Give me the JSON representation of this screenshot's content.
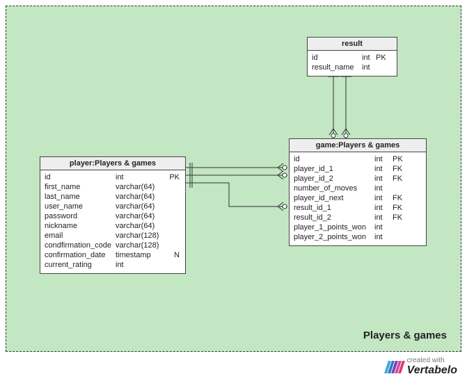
{
  "group_label": "Players & games",
  "tables": {
    "result": {
      "title": "result",
      "cols": [
        {
          "name": "id",
          "type": "int",
          "flags": "PK"
        },
        {
          "name": "result_name",
          "type": "int",
          "flags": ""
        }
      ]
    },
    "game": {
      "title": "game:Players & games",
      "cols": [
        {
          "name": "id",
          "type": "int",
          "flags": "PK"
        },
        {
          "name": "player_id_1",
          "type": "int",
          "flags": "FK"
        },
        {
          "name": "player_id_2",
          "type": "int",
          "flags": "FK"
        },
        {
          "name": "number_of_moves",
          "type": "int",
          "flags": ""
        },
        {
          "name": "player_id_next",
          "type": "int",
          "flags": "FK"
        },
        {
          "name": "result_id_1",
          "type": "int",
          "flags": "FK"
        },
        {
          "name": "result_id_2",
          "type": "int",
          "flags": "FK"
        },
        {
          "name": "player_1_points_won",
          "type": "int",
          "flags": ""
        },
        {
          "name": "player_2_points_won",
          "type": "int",
          "flags": ""
        }
      ]
    },
    "player": {
      "title": "player:Players & games",
      "cols": [
        {
          "name": "id",
          "type": "int",
          "flags": "PK"
        },
        {
          "name": "first_name",
          "type": "varchar(64)",
          "flags": ""
        },
        {
          "name": "last_name",
          "type": "varchar(64)",
          "flags": ""
        },
        {
          "name": "user_name",
          "type": "varchar(64)",
          "flags": ""
        },
        {
          "name": "password",
          "type": "varchar(64)",
          "flags": ""
        },
        {
          "name": "nickname",
          "type": "varchar(64)",
          "flags": ""
        },
        {
          "name": "email",
          "type": "varchar(128)",
          "flags": ""
        },
        {
          "name": "condfirmation_code",
          "type": "varchar(128)",
          "flags": ""
        },
        {
          "name": "confirmation_date",
          "type": "timestamp",
          "flags": "N"
        },
        {
          "name": "current_rating",
          "type": "int",
          "flags": ""
        }
      ]
    }
  },
  "watermark": {
    "prefix": "created with",
    "brand": "Vertabelo",
    "colors": [
      "#3aa6dd",
      "#2a7bbd",
      "#7a3fb5",
      "#d24a9a",
      "#e23b67"
    ]
  }
}
